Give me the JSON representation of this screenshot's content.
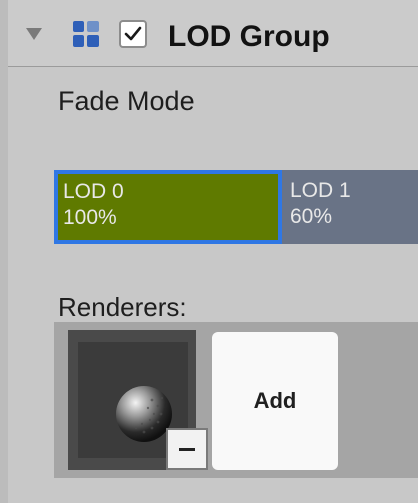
{
  "component": {
    "title": "LOD Group",
    "enabled": true,
    "icon": "lod-group-icon",
    "foldout_icon": "foldout-triangle-down-icon"
  },
  "fade_mode": {
    "label": "Fade Mode"
  },
  "lods": [
    {
      "name": "LOD 0",
      "percent": "100%",
      "color": "#5f7a00",
      "selected": true
    },
    {
      "name": "LOD 1",
      "percent": "60%",
      "color": "#697386",
      "selected": false
    }
  ],
  "renderers": {
    "label": "Renderers:",
    "add_label": "Add",
    "remove_icon": "minus-icon",
    "thumbnail_icon": "sphere-mesh-icon"
  },
  "colors": {
    "selection": "#2f77e4",
    "panel_bg": "#c8c8c8"
  }
}
